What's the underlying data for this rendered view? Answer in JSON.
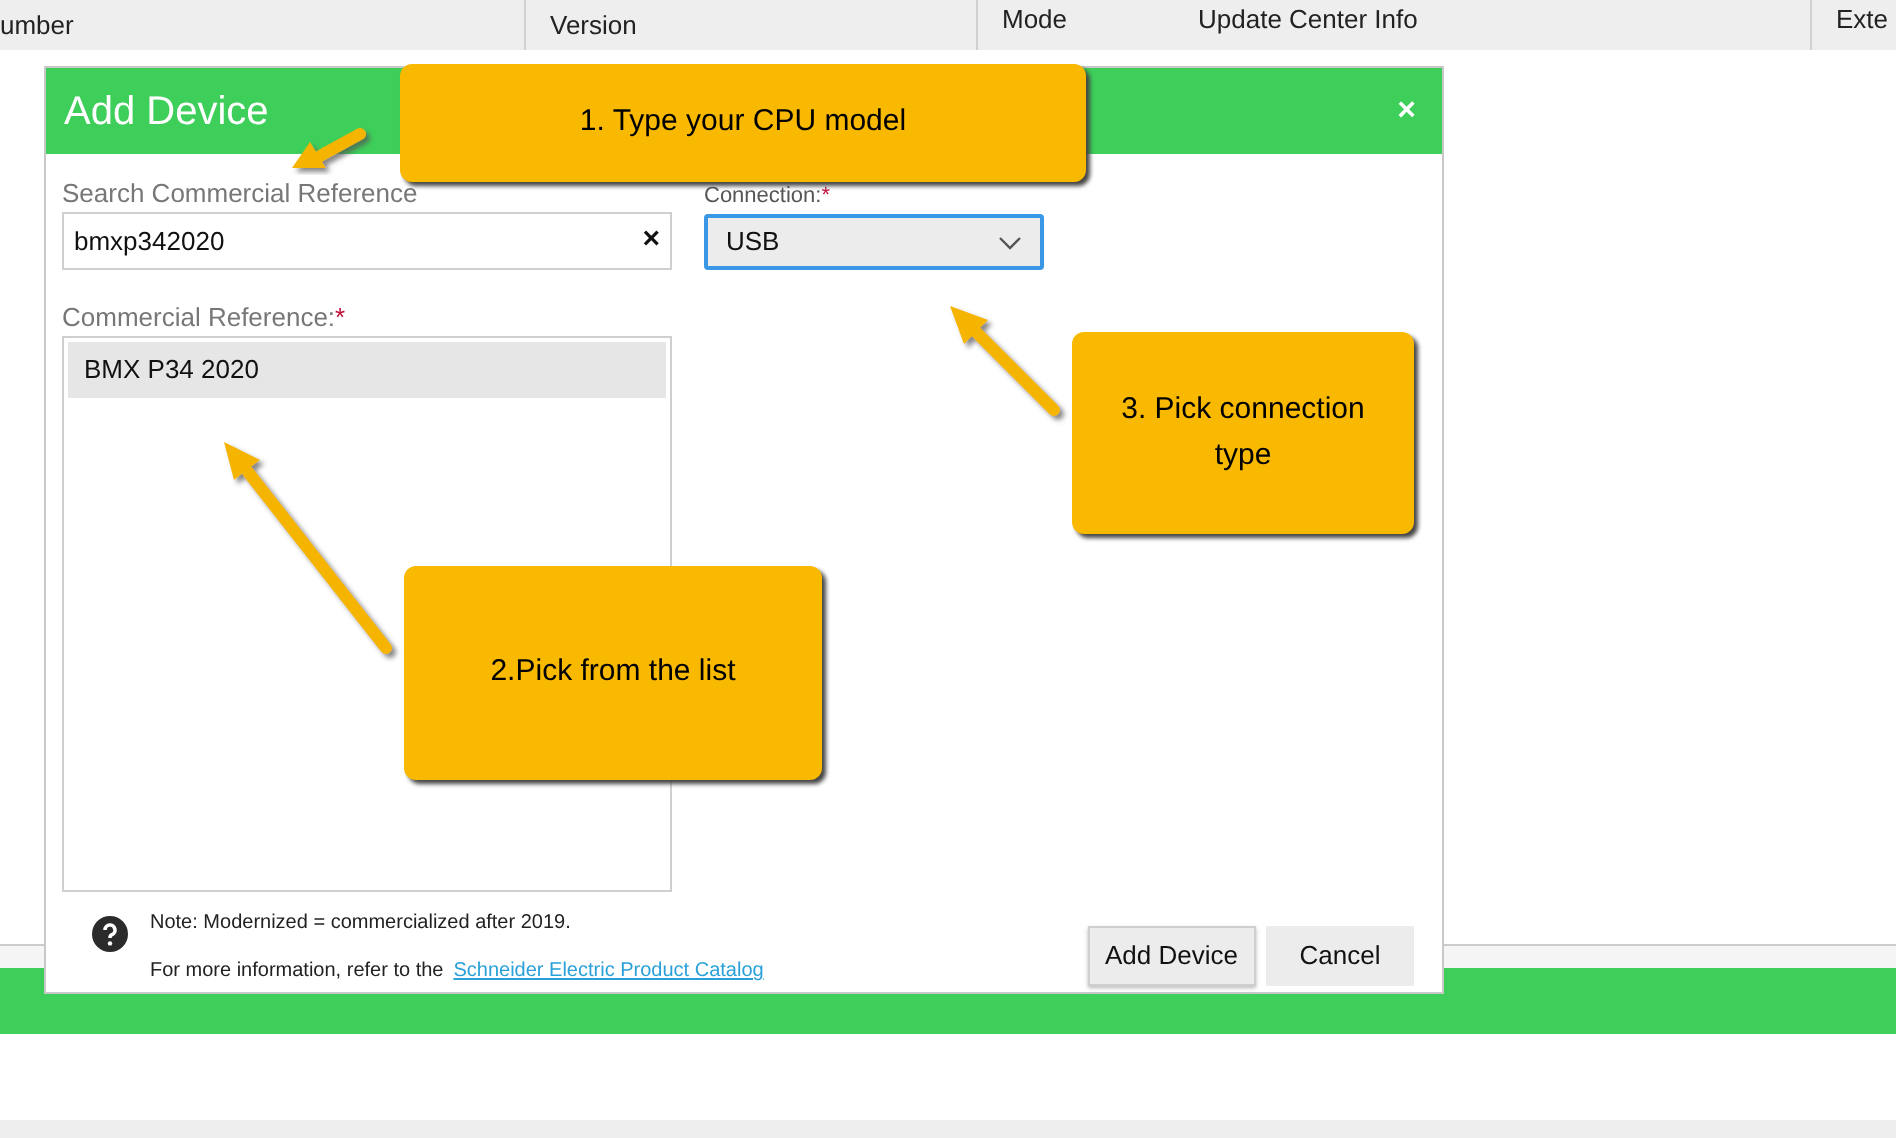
{
  "background_table": {
    "columns": [
      "umber",
      "Version",
      "Mode",
      "Update Center Info",
      "Exte"
    ]
  },
  "dialog": {
    "title": "Add Device",
    "close": "×",
    "search": {
      "label": "Search Commercial Reference",
      "value": "bmxp342020",
      "clear": "×"
    },
    "connection": {
      "label": "Connection:",
      "required_mark": "*",
      "value": "USB"
    },
    "commercial_reference": {
      "label": "Commercial Reference:",
      "required_mark": "*",
      "items": [
        {
          "text": "BMX P34 2020",
          "selected": true
        }
      ]
    },
    "note": "Note: Modernized = commercialized after 2019.",
    "info": "For more information, refer to the",
    "link": "Schneider Electric Product Catalog",
    "buttons": [
      {
        "label": "Add Device",
        "kind": "primary"
      },
      {
        "label": "Cancel",
        "kind": "secondary"
      }
    ]
  },
  "callouts": [
    {
      "text": "1. Type your CPU model"
    },
    {
      "text": "2.Pick from the list"
    },
    {
      "text": "3. Pick connection type"
    }
  ]
}
